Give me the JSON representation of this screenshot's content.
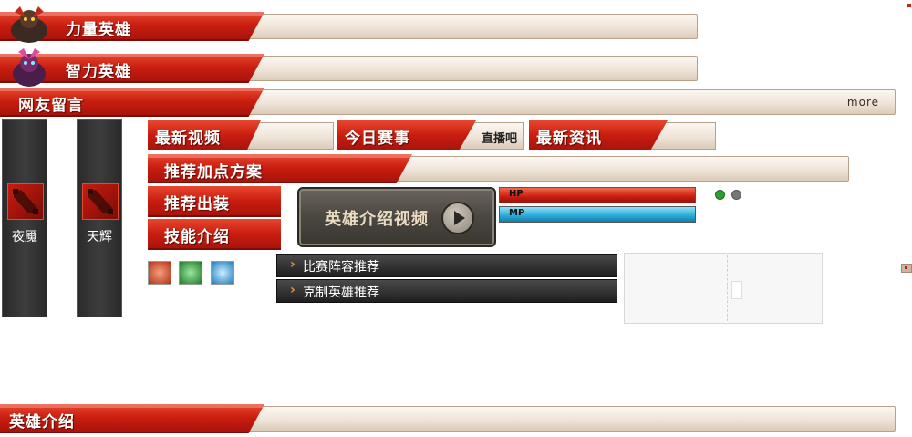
{
  "sections": {
    "strength": "力量英雄",
    "intelligence": "智力英雄",
    "comments": "网友留言",
    "comments_more": "more",
    "hero_intro": "英雄介绍"
  },
  "factions": [
    {
      "label": "夜魇"
    },
    {
      "label": "天辉"
    }
  ],
  "tabs": {
    "latest_video": "最新视频",
    "today_match": "今日赛事",
    "today_match_sub": "直播吧",
    "latest_news": "最新资讯",
    "recommend_points": "推荐加点方案",
    "recommend_items": "推荐出装",
    "skills": "技能介绍"
  },
  "video_button": "英雄介绍视频",
  "stats": {
    "hp": "HP",
    "mp": "MP"
  },
  "recommend": {
    "lineup": "比赛阵容推荐",
    "counter": "克制英雄推荐"
  },
  "colors": {
    "accent_red": "#c91d10",
    "mp_blue": "#29a9d8",
    "dot_active": "#2e9e2e",
    "dot_inactive": "#777777"
  }
}
